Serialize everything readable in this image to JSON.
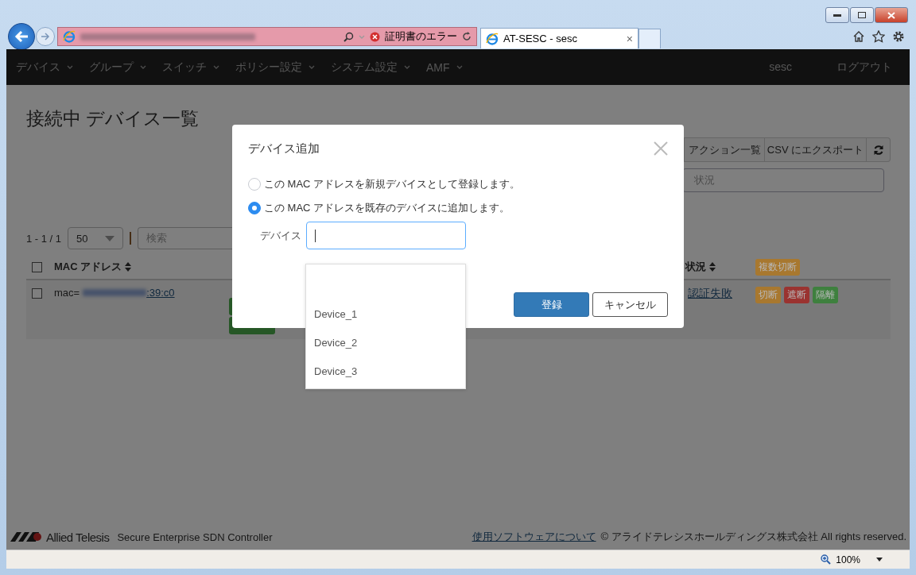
{
  "browser": {
    "cert_error": "証明書のエラー",
    "tabs": [
      {
        "title": "AT-SESC - sesc",
        "close": "×"
      }
    ]
  },
  "navbar": {
    "menus": [
      {
        "label": "デバイス"
      },
      {
        "label": "グループ"
      },
      {
        "label": "スイッチ"
      },
      {
        "label": "ポリシー設定"
      },
      {
        "label": "システム設定"
      },
      {
        "label": "AMF"
      }
    ],
    "user": "sesc",
    "logout": "ログアウト"
  },
  "page": {
    "title": "接続中 デバイス一覧",
    "toolbar": [
      "アクション一覧",
      "CSV にエクスポート"
    ],
    "filter_placeholder": "状況",
    "pagination": {
      "range": "1 - 1 / 1",
      "page_size": "50",
      "search_placeholder": "検索"
    },
    "table": {
      "header_checked": false,
      "columns": [
        {
          "label": "MAC アドレス",
          "sortable": true
        },
        {
          "label": "状況",
          "sortable": true
        }
      ],
      "bulk_action": {
        "label": "複数切断",
        "color": "#a8782f"
      },
      "rows": [
        {
          "checked": false,
          "mac_prefix": "mac=",
          "mac_suffix": ":39:c0",
          "status": "認証失敗",
          "actions": [
            {
              "label": "切断",
              "color": "#a8782f"
            },
            {
              "label": "遮断",
              "color": "#9a3330"
            },
            {
              "label": "隔離",
              "color": "#3e803e"
            }
          ]
        }
      ]
    }
  },
  "dialog": {
    "title": "デバイス追加",
    "options": [
      {
        "label": "この MAC アドレスを新規デバイスとして登録します。",
        "selected": false
      },
      {
        "label": "この MAC アドレスを既存のデバイスに追加します。",
        "selected": true
      }
    ],
    "device_label": "デバイス",
    "device_options": [
      "Device_1",
      "Device_2",
      "Device_3"
    ],
    "submit": "登録",
    "cancel": "キャンセル"
  },
  "footer": {
    "brand": "Allied Telesis",
    "product": "Secure Enterprise SDN Controller",
    "link": "使用ソフトウェアについて",
    "copyright": "© アライドテレシスホールディングス株式会社 All rights reserved."
  },
  "status_bar": {
    "zoom": "100%"
  }
}
